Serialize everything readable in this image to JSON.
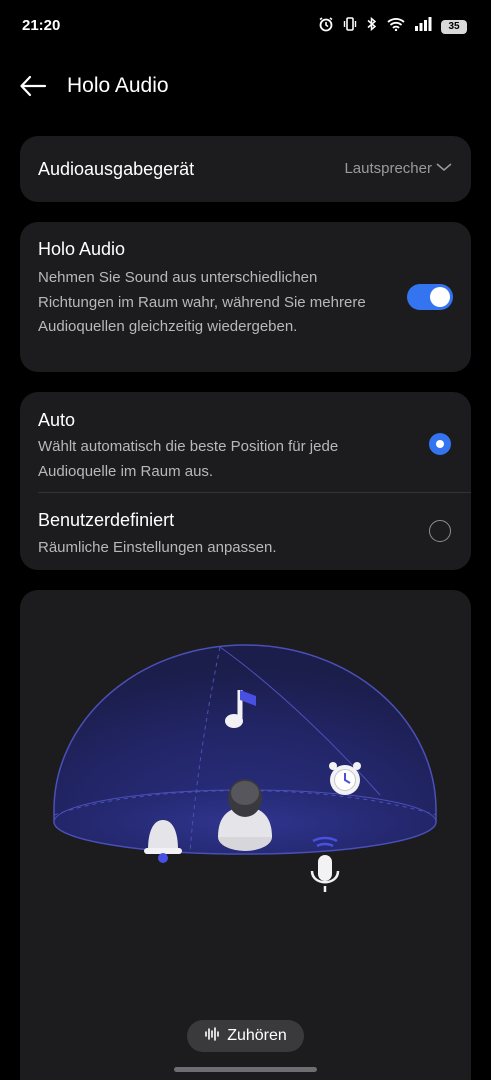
{
  "status": {
    "time": "21:20",
    "battery": "35",
    "icons": [
      "alarm-icon",
      "vibrate-icon",
      "bluetooth-icon",
      "wifi-icon",
      "signal-icon",
      "battery-icon"
    ]
  },
  "header": {
    "title": "Holo Audio",
    "back_icon": "arrow-left-icon"
  },
  "output": {
    "label": "Audioausgabegerät",
    "value": "Lautsprecher"
  },
  "holo": {
    "title": "Holo Audio",
    "description": "Nehmen Sie Sound aus unterschiedlichen Richtungen im Raum wahr, während Sie mehrere Audioquellen gleichzeitig wiedergeben.",
    "enabled": true
  },
  "modes": [
    {
      "title": "Auto",
      "description": "Wählt automatisch die beste Position für jede Audioquelle im Raum aus.",
      "selected": true
    },
    {
      "title": "Benutzerdefiniert",
      "description": "Räumliche Einstellungen anpassen.",
      "selected": false
    }
  ],
  "preview": {
    "listen_label": "Zuhören",
    "icons": [
      "music-note-icon",
      "alarm-clock-icon",
      "bell-icon",
      "microphone-icon",
      "listener-avatar-icon"
    ]
  },
  "colors": {
    "accent": "#3574f0",
    "card": "#1c1c1e",
    "background": "#000000"
  }
}
